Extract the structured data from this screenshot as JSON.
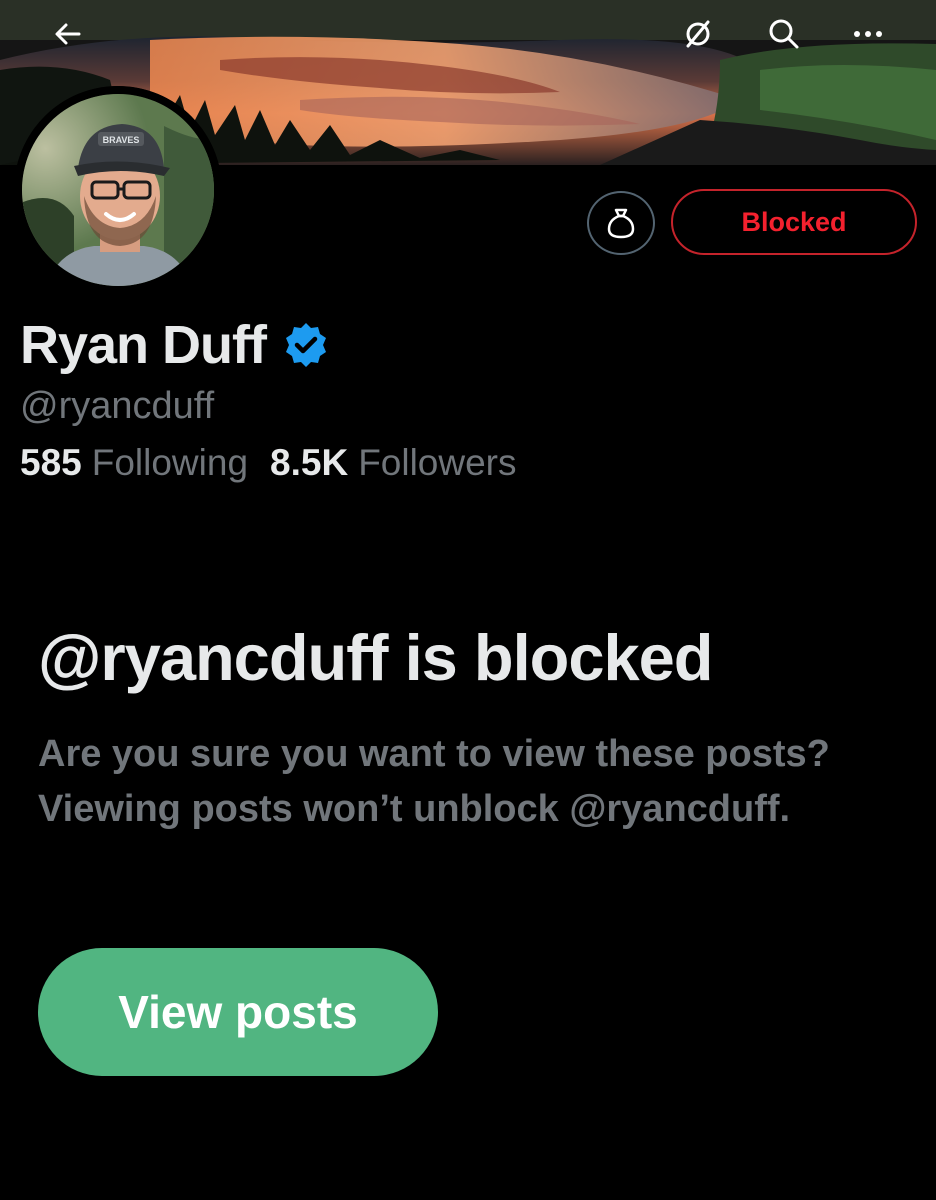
{
  "header": {
    "back_icon": "arrow-left-icon",
    "grok_icon": "grok-icon",
    "search_icon": "search-icon",
    "more_icon": "more-horizontal-icon"
  },
  "profile": {
    "display_name": "Ryan Duff",
    "verified": true,
    "handle": "@ryancduff",
    "following_count": "585",
    "following_label": "Following",
    "followers_count": "8.5K",
    "followers_label": "Followers",
    "avatar_icon": "avatar-photo",
    "avatar_cap_text": "BRAVES"
  },
  "actions": {
    "grok_bag_icon": "money-bag-icon",
    "blocked_label": "Blocked"
  },
  "notice": {
    "title": "@ryancduff is blocked",
    "description": "Are you sure you want to view these posts? Viewing posts won’t unblock @ryancduff.",
    "view_button_label": "View posts"
  },
  "colors": {
    "background": "#000000",
    "primary_text": "#e7e9ea",
    "secondary_text": "#71767b",
    "blocked_red": "#f4212e",
    "view_button_green": "#51b581",
    "verified_blue": "#1d9bf0"
  }
}
